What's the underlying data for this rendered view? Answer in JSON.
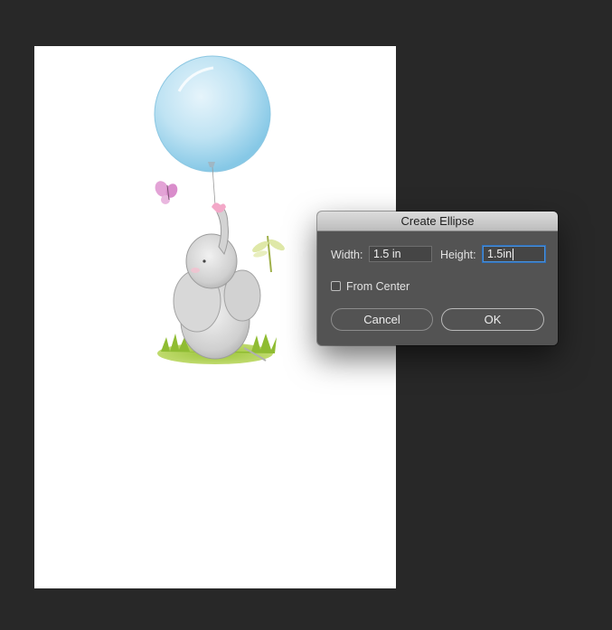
{
  "dialog": {
    "title": "Create Ellipse",
    "width_label": "Width:",
    "width_value": "1.5 in",
    "height_label": "Height:",
    "height_value": "1.5in",
    "from_center_label": "From Center",
    "from_center_checked": false,
    "cancel_label": "Cancel",
    "ok_label": "OK"
  },
  "colors": {
    "workspace_bg": "#282828",
    "canvas_bg": "#ffffff",
    "dialog_bg": "#535353",
    "focus_ring": "#4a90d9"
  }
}
